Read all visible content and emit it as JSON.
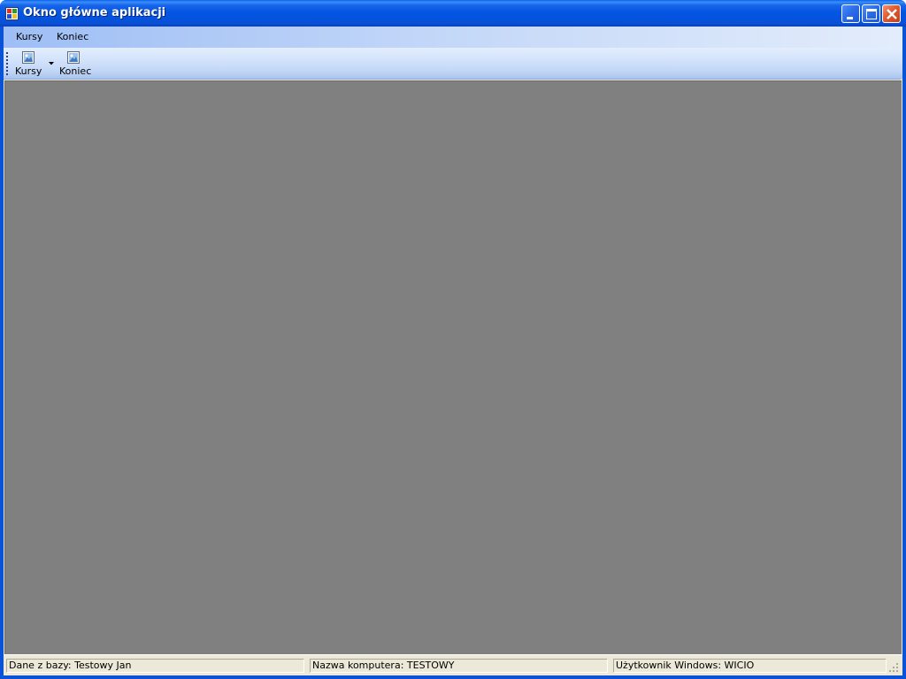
{
  "window": {
    "title": "Okno główne aplikacji"
  },
  "menubar": {
    "items": [
      {
        "label": "Kursy"
      },
      {
        "label": "Koniec"
      }
    ]
  },
  "toolbar": {
    "buttons": [
      {
        "label": "Kursy",
        "icon": "image-icon",
        "has_dropdown": true
      },
      {
        "label": "Koniec",
        "icon": "image-icon",
        "has_dropdown": false
      }
    ]
  },
  "statusbar": {
    "panels": [
      {
        "text": "Dane z bazy: Testowy Jan"
      },
      {
        "text": "Nazwa komputera: TESTOWY"
      },
      {
        "text": "Użytkownik Windows: WICIO"
      }
    ]
  },
  "colors": {
    "title_bar": "#0456e2",
    "mdi_background": "#808080",
    "menu_bar_start": "#9ebef5",
    "status_bar": "#ece9d8"
  }
}
